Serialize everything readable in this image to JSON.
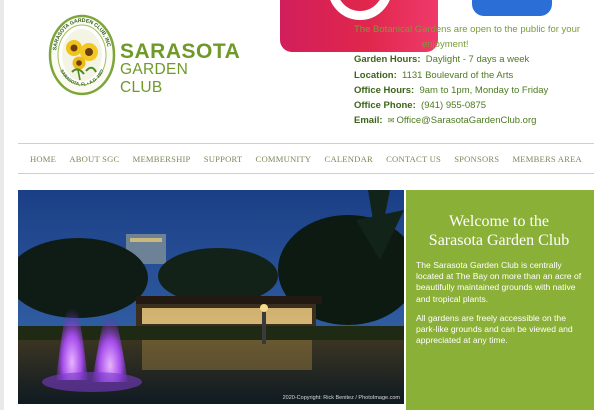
{
  "brand": {
    "line1": "SARASOTA",
    "line2": "GARDEN CLUB",
    "seal_top_text": "SARASOTA GARDEN CLUB, INC",
    "seal_bottom_text": "SARASOTA, FL • A.D. 1927"
  },
  "info": {
    "tagline_1": "The Botanical Gardens are open to the public for your",
    "tagline_2": "enjoyment!",
    "rows": [
      {
        "label": "Garden Hours:",
        "value": "Daylight - 7 days a week"
      },
      {
        "label": "Location:",
        "value": "1131 Boulevard of the Arts"
      },
      {
        "label": "Office Hours:",
        "value": "9am to 1pm, Monday to Friday"
      },
      {
        "label": "Office Phone:",
        "value": "(941) 955-0875"
      },
      {
        "label": "Email:",
        "value": "Office@SarasotaGardenClub.org"
      }
    ]
  },
  "nav": [
    "HOME",
    "ABOUT SGC",
    "MEMBERSHIP",
    "SUPPORT",
    "COMMUNITY",
    "CALENDAR",
    "CONTACT US",
    "SPONSORS",
    "MEMBERS AREA"
  ],
  "hero": {
    "credit": "2020-Copyright: Rick Benitez / PhotoImage.com",
    "welcome_title_1": "Welcome to the",
    "welcome_title_2": "Sarasota Garden Club",
    "para_1": "The Sarasota Garden Club is centrally located at The Bay on more than an acre of beautifully maintained grounds with native and tropical plants.",
    "para_2": "All gardens are freely accessible on the park-like grounds and can be viewed and appreciated at any time."
  },
  "colors": {
    "brand_green": "#6f9a2a",
    "welcome_panel": "#8bb038",
    "instagram": "#e0264c"
  },
  "icons": [
    "instagram-icon",
    "mail-icon",
    "garden-club-seal-logo"
  ]
}
